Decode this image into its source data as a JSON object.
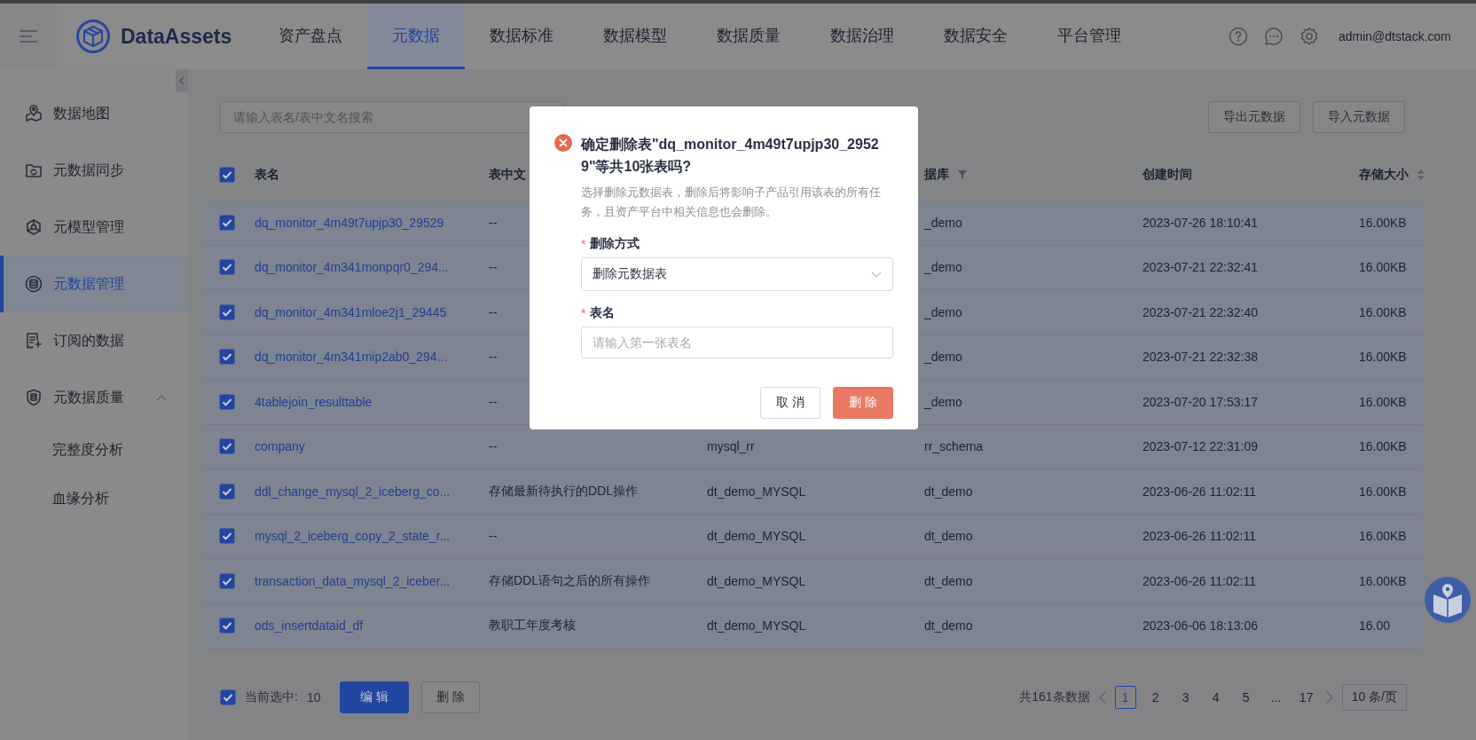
{
  "header": {
    "brand": "DataAssets",
    "nav": [
      {
        "label": "资产盘点",
        "selected": false
      },
      {
        "label": "元数据",
        "selected": true
      },
      {
        "label": "数据标准",
        "selected": false
      },
      {
        "label": "数据模型",
        "selected": false
      },
      {
        "label": "数据质量",
        "selected": false
      },
      {
        "label": "数据治理",
        "selected": false
      },
      {
        "label": "数据安全",
        "selected": false
      },
      {
        "label": "平台管理",
        "selected": false
      }
    ],
    "user": "admin@dtstack.com"
  },
  "sidebar": {
    "items": [
      {
        "label": "数据地图",
        "selected": false
      },
      {
        "label": "元数据同步",
        "selected": false
      },
      {
        "label": "元模型管理",
        "selected": false
      },
      {
        "label": "元数据管理",
        "selected": true
      },
      {
        "label": "订阅的数据",
        "selected": false
      },
      {
        "label": "元数据质量",
        "selected": false,
        "expanded": true,
        "children": [
          {
            "label": "完整度分析"
          },
          {
            "label": "血缘分析"
          }
        ]
      }
    ]
  },
  "toolbar": {
    "search": {
      "placeholder": "请输入表名/表中文名搜索"
    },
    "buttons": [
      "导出元数据",
      "导入元数据"
    ]
  },
  "table": {
    "all_checked": true,
    "columns": [
      {
        "label": "表名",
        "kind": "plain"
      },
      {
        "label": "表中文",
        "kind": "plain"
      },
      {
        "kind": "plain"
      },
      {
        "label": "据库",
        "kind": "filter"
      },
      {
        "label": "创建时间",
        "kind": "plain"
      },
      {
        "label": "存储大小",
        "kind": "sort"
      }
    ],
    "rows": [
      {
        "selected": true,
        "cells": [
          "dq_monitor_4m49t7upjp30_29529",
          "--",
          "",
          "_demo",
          "2023-07-26 18:10:41",
          "16.00KB"
        ]
      },
      {
        "selected": true,
        "cells": [
          "dq_monitor_4m341monpqr0_294...",
          "--",
          "",
          "_demo",
          "2023-07-21 22:32:41",
          "16.00KB"
        ]
      },
      {
        "selected": true,
        "cells": [
          "dq_monitor_4m341mloe2j1_29445",
          "--",
          "",
          "_demo",
          "2023-07-21 22:32:40",
          "16.00KB"
        ]
      },
      {
        "selected": true,
        "cells": [
          "dq_monitor_4m341mip2ab0_294...",
          "--",
          "",
          "_demo",
          "2023-07-21 22:32:38",
          "16.00KB"
        ]
      },
      {
        "selected": true,
        "cells": [
          "4tablejoin_resulttable",
          "--",
          "",
          "_demo",
          "2023-07-20 17:53:17",
          "16.00KB"
        ]
      },
      {
        "selected": true,
        "cells": [
          "company",
          "--",
          "mysql_rr",
          "rr_schema",
          "2023-07-12 22:31:09",
          "16.00KB"
        ]
      },
      {
        "selected": true,
        "cells": [
          "ddl_change_mysql_2_iceberg_co...",
          "存储最新待执行的DDL操作",
          "dt_demo_MYSQL",
          "dt_demo",
          "2023-06-26 11:02:11",
          "16.00KB"
        ]
      },
      {
        "selected": true,
        "cells": [
          "mysql_2_iceberg_copy_2_state_r...",
          "--",
          "dt_demo_MYSQL",
          "dt_demo",
          "2023-06-26 11:02:11",
          "16.00KB"
        ]
      },
      {
        "selected": true,
        "cells": [
          "transaction_data_mysql_2_iceber...",
          "存储DDL语句之后的所有操作",
          "dt_demo_MYSQL",
          "dt_demo",
          "2023-06-26 11:02:11",
          "16.00KB"
        ]
      },
      {
        "selected": true,
        "cells": [
          "ods_insertdataid_df",
          "教职工年度考核",
          "dt_demo_MYSQL",
          "dt_demo",
          "2023-06-06 18:13:06",
          "16.00"
        ]
      }
    ]
  },
  "footer": {
    "checked": true,
    "selected_label": "当前选中:",
    "selected_count": "10",
    "buttons": [
      {
        "label": "编 辑",
        "kind": "primary"
      },
      {
        "label": "删 除",
        "kind": "default"
      }
    ],
    "pagination": {
      "total": "共161条数据",
      "pages": [
        {
          "label": "1",
          "selected": true
        },
        {
          "label": "2",
          "selected": false
        },
        {
          "label": "3",
          "selected": false
        },
        {
          "label": "4",
          "selected": false
        },
        {
          "label": "5",
          "selected": false
        },
        {
          "label": "...",
          "selected": false
        },
        {
          "label": "17",
          "selected": false
        }
      ],
      "page_size": "10 条/页"
    }
  },
  "dialog": {
    "title": "确定删除表\"dq_monitor_4m49t7upjp30_29529\"等共10张表吗?",
    "description": "选择删除元数据表，删除后将影响子产品引用该表的所有任务，且资产平台中相关信息也会删除。",
    "fields": [
      {
        "label": "删除方式",
        "required_mark": "*",
        "kind": "select",
        "value": "删除元数据表"
      },
      {
        "label": "表名",
        "required_mark": "*",
        "kind": "input",
        "placeholder": "请输入第一张表名"
      }
    ],
    "buttons": [
      {
        "label": "取 消",
        "kind": "default"
      },
      {
        "label": "删 除",
        "kind": "danger"
      }
    ]
  }
}
